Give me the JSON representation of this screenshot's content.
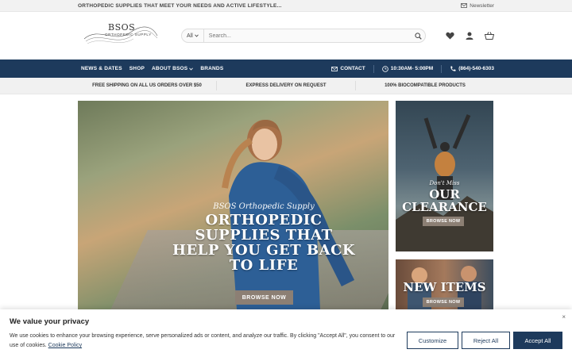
{
  "topbar": {
    "tagline": "ORTHOPEDIC SUPPLIES THAT MEET YOUR NEEDS AND ACTIVE LIFESTYLE...",
    "newsletter": "Newsletter"
  },
  "logo": {
    "brand": "BSOS",
    "sub": "ORTHOPEDIC SUPPLY"
  },
  "search": {
    "category": "All",
    "placeholder": "Search..."
  },
  "nav": {
    "items": [
      "NEWS & DATES",
      "SHOP",
      "ABOUT BSOS",
      "BRANDS"
    ],
    "contact": "CONTACT",
    "hours": "10:30AM- 5:00PM",
    "phone": "(864)-540-6303"
  },
  "perks": [
    "FREE SHIPPING ON ALL US ORDERS OVER $50",
    "EXPRESS DELIVERY ON REQUEST",
    "100% BIOCOMPATIBLE PRODUCTS"
  ],
  "hero": {
    "script": "BSOS Orthopedic Supply",
    "headline": "ORTHOPEDIC SUPPLIES THAT HELP YOU GET BACK TO LIFE",
    "button": "BROWSE NOW"
  },
  "card1": {
    "script": "Don't Miss",
    "title": "OUR CLEARANCE",
    "button": "BROWSE NOW"
  },
  "card2": {
    "title": "NEW ITEMS",
    "button": "BROWSE NOW"
  },
  "cookie": {
    "title": "We value your privacy",
    "text": "We use cookies to enhance your browsing experience, serve personalized ads or content, and analyze our traffic. By clicking \"Accept All\", you consent to our use of cookies.",
    "policy": "Cookie Policy",
    "customize": "Customize",
    "reject": "Reject All",
    "accept": "Accept All",
    "close": "×"
  },
  "colors": {
    "nav": "#1d3a5c",
    "button": "#8c7f74"
  }
}
